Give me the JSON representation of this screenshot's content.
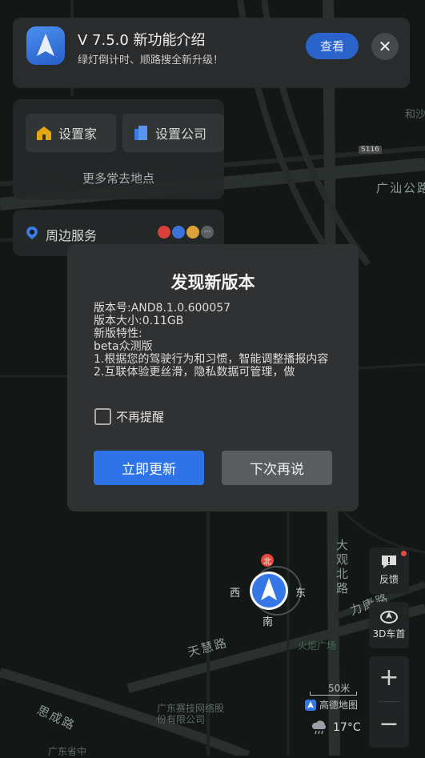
{
  "map": {
    "road_labels": [
      "广汕公路",
      "天慧路",
      "思成路",
      "大观北路",
      "力康路"
    ],
    "poi_labels": [
      "广东赛技网络股份有限公司",
      "广东省中",
      "和沙",
      "火炬广场",
      "S116"
    ]
  },
  "notice": {
    "title": "V 7.5.0 新功能介绍",
    "subtitle": "绿灯倒计时、顺路搜全新升级！",
    "view_label": "查看",
    "close_label": "✕"
  },
  "shortcuts": {
    "home_label": "设置家",
    "company_label": "设置公司",
    "more_label": "更多常去地点"
  },
  "nearby": {
    "label": "周边服务",
    "more_dots": "···"
  },
  "dialog": {
    "title": "发现新版本",
    "version": "版本号:AND8.1.0.600057",
    "size": "版本大小:0.11GB",
    "features_heading": "新版特性:",
    "beta": "beta众测版",
    "feature_1": "1.根据您的驾驶行为和习惯，智能调整播报内容",
    "feature_2": "2.互联体验更丝滑，隐私数据可管理，做",
    "dont_remind_label": "不再提醒",
    "update_now_label": "立即更新",
    "later_label": "下次再说"
  },
  "controls": {
    "feedback_label": "反馈",
    "view_3d_label": "3D车首",
    "zoom_in": "+",
    "zoom_out": "−"
  },
  "compass": {
    "north": "北",
    "west": "西",
    "east": "东",
    "south": "南"
  },
  "scale": {
    "label": "50米"
  },
  "brand": {
    "label": "高德地图"
  },
  "weather": {
    "temperature": "17°C"
  },
  "colors": {
    "accent": "#2f73e8",
    "background": "#121715"
  }
}
